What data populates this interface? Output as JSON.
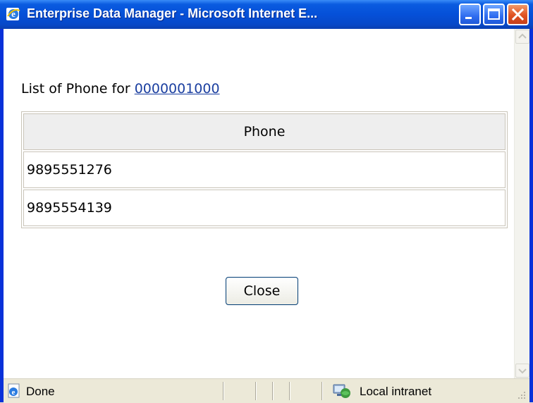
{
  "window": {
    "title": "Enterprise Data Manager - Microsoft Internet E...",
    "controls": [
      "minimize-icon",
      "maximize-icon",
      "close-icon"
    ]
  },
  "content": {
    "heading_prefix": "List of Phone for",
    "heading_link": "0000001000",
    "table": {
      "header": "Phone",
      "rows": [
        "9895551276",
        "9895554139"
      ]
    },
    "close_label": "Close"
  },
  "statusbar": {
    "status": "Done",
    "zone": "Local intranet"
  },
  "colors": {
    "titlebar": "#0550D8",
    "link": "#1B3FA0",
    "table_header_bg": "#EEEEEE"
  }
}
